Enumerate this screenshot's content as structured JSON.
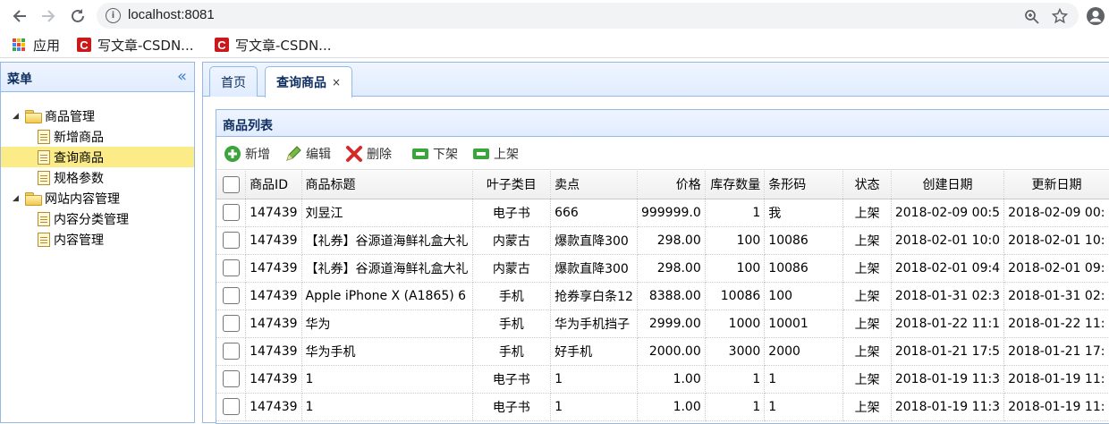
{
  "browser": {
    "url": "localhost:8081",
    "bookmarks": [
      {
        "label": "应用",
        "icon": "apps-icon"
      },
      {
        "label": "写文章-CSDN...",
        "icon": "csdn-icon"
      },
      {
        "label": "写文章-CSDN...",
        "icon": "csdn-icon"
      }
    ]
  },
  "west": {
    "title": "菜单",
    "collapse_glyph": "«",
    "tree": [
      {
        "label": "商品管理",
        "type": "folder"
      },
      {
        "label": "新增商品",
        "type": "file"
      },
      {
        "label": "查询商品",
        "type": "file",
        "selected": true
      },
      {
        "label": "规格参数",
        "type": "file"
      },
      {
        "label": "网站内容管理",
        "type": "folder"
      },
      {
        "label": "内容分类管理",
        "type": "file"
      },
      {
        "label": "内容管理",
        "type": "file"
      }
    ]
  },
  "tabs": [
    {
      "label": "首页",
      "active": false
    },
    {
      "label": "查询商品",
      "active": true,
      "close": "×"
    }
  ],
  "panel": {
    "title": "商品列表",
    "toolbar": {
      "add": "新增",
      "edit": "编辑",
      "delete": "删除",
      "off_shelf": "下架",
      "on_shelf": "上架"
    }
  },
  "grid": {
    "columns": [
      "商品ID",
      "商品标题",
      "叶子类目",
      "卖点",
      "价格",
      "库存数量",
      "条形码",
      "状态",
      "创建日期",
      "更新日期"
    ],
    "rows": [
      [
        "147439",
        "刘昱江",
        "电子书",
        "666",
        "999999.0",
        "1",
        "我",
        "上架",
        "2018-02-09 00:5",
        "2018-02-09 00:"
      ],
      [
        "147439",
        "【礼券】谷源道海鲜礼盒大礼",
        "内蒙古",
        "爆款直降300",
        "298.00",
        "100",
        "10086",
        "上架",
        "2018-02-01 10:0",
        "2018-02-01 10:"
      ],
      [
        "147439",
        "【礼券】谷源道海鲜礼盒大礼",
        "内蒙古",
        "爆款直降300",
        "298.00",
        "100",
        "10086",
        "上架",
        "2018-02-01 09:4",
        "2018-02-01 09:"
      ],
      [
        "147439",
        "Apple iPhone X (A1865) 6",
        "手机",
        "抢券享白条12",
        "8388.00",
        "10086",
        "100",
        "上架",
        "2018-01-31 02:3",
        "2018-01-31 02:"
      ],
      [
        "147439",
        "华为",
        "手机",
        "华为手机挡子",
        "2999.00",
        "1000",
        "10001",
        "上架",
        "2018-01-22 11:1",
        "2018-01-22 11:"
      ],
      [
        "147439",
        "华为手机",
        "手机",
        "好手机",
        "2000.00",
        "3000",
        "2000",
        "上架",
        "2018-01-21 17:5",
        "2018-01-21 17:"
      ],
      [
        "147439",
        "1",
        "电子书",
        "1",
        "1.00",
        "1",
        "1",
        "上架",
        "2018-01-19 11:3",
        "2018-01-19 11:"
      ],
      [
        "147439",
        "1",
        "电子书",
        "1",
        "1.00",
        "1",
        "1",
        "上架",
        "2018-01-19 11:3",
        "2018-01-19 11:"
      ]
    ]
  },
  "colors": {
    "accent": "#95b8e7",
    "selected": "#fbec88",
    "on_shelf": "#1a7f1a"
  }
}
